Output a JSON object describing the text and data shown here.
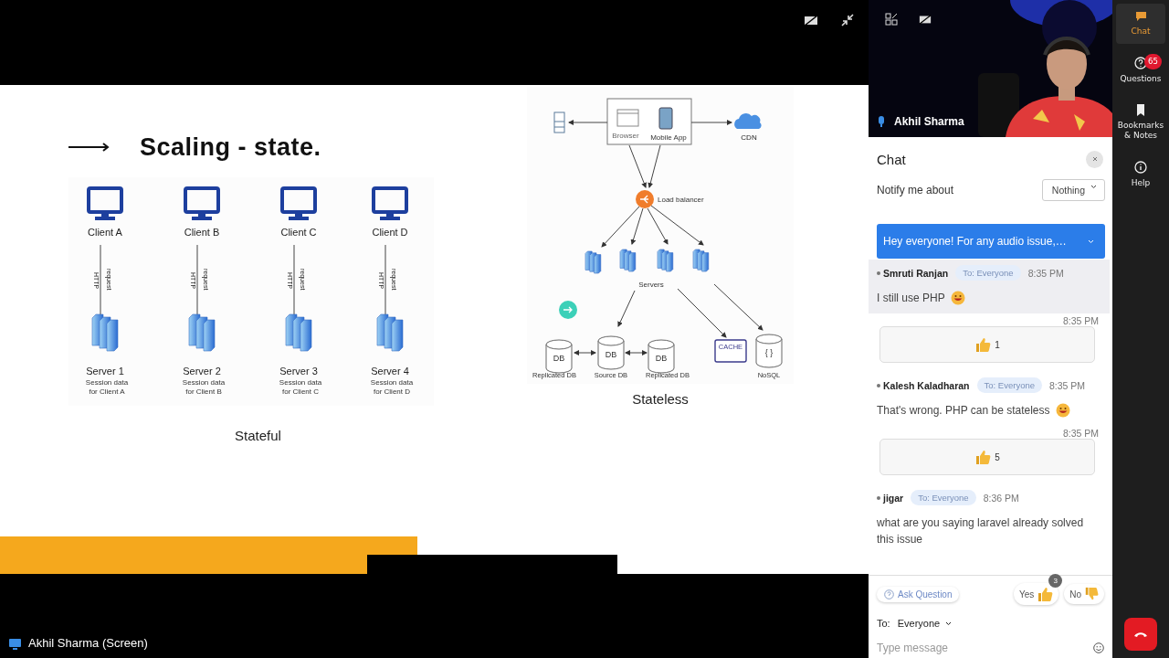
{
  "stage": {
    "presenter_label": "Akhil Sharma (Screen)",
    "slide": {
      "title": "Scaling - state.",
      "stateful": {
        "caption": "Stateful",
        "clients": [
          {
            "client": "Client A",
            "http": "HTTP",
            "request": "request",
            "server": "Server 1",
            "session": "Session data",
            "session_for": "for Client A"
          },
          {
            "client": "Client B",
            "http": "HTTP",
            "request": "request",
            "server": "Server 2",
            "session": "Session data",
            "session_for": "for Client B"
          },
          {
            "client": "Client C",
            "http": "HTTP",
            "request": "request",
            "server": "Server 3",
            "session": "Session data",
            "session_for": "for Client C"
          },
          {
            "client": "Client D",
            "http": "HTTP",
            "request": "request",
            "server": "Server 4",
            "session": "Session data",
            "session_for": "for Client D"
          }
        ]
      },
      "stateless": {
        "caption": "Stateless",
        "browser": "Browser",
        "mobile_app": "Mobile App",
        "cdn": "CDN",
        "load_balancer": "Load balancer",
        "servers": "Servers",
        "cache": "CACHE",
        "nosql_symbol": "{ }",
        "nosql": "NoSQL",
        "databases": [
          {
            "symbol": "DB",
            "label": "Replicated DB"
          },
          {
            "symbol": "DB",
            "label": "Source DB"
          },
          {
            "symbol": "DB",
            "label": "Replicated DB"
          }
        ]
      }
    }
  },
  "video": {
    "name": "Akhil Sharma",
    "mic_on": true
  },
  "chat": {
    "title": "Chat",
    "notify_label": "Notify me about",
    "notify_value": "Nothing",
    "pinned": "Hey everyone! For any audio issue,…",
    "messages": [
      {
        "kind": "message",
        "author": "Smruti Ranjan",
        "to": "To: Everyone",
        "time": "8:35 PM",
        "text": "I still use PHP",
        "emoji": true,
        "highlighted": true
      },
      {
        "kind": "reaction",
        "time": "8:35 PM",
        "count": "1"
      },
      {
        "kind": "message",
        "author": "Kalesh Kaladharan",
        "to": "To: Everyone",
        "time": "8:35 PM",
        "text": "That's wrong. PHP can be stateless",
        "emoji": true,
        "highlighted": false
      },
      {
        "kind": "reaction",
        "time": "8:35 PM",
        "count": "5"
      },
      {
        "kind": "message",
        "author": "jigar",
        "to": "To: Everyone",
        "time": "8:36 PM",
        "text": "what are you saying laravel already solved this issue",
        "emoji": false,
        "highlighted": false
      }
    ],
    "ask": "Ask Question",
    "yes": "Yes",
    "yes_count": "3",
    "no": "No",
    "to_label": "To:",
    "to_value": "Everyone",
    "placeholder": "Type message"
  },
  "rail": [
    {
      "kind": "chat",
      "label": "Chat",
      "selected": true
    },
    {
      "kind": "questions",
      "label": "Questions",
      "badge": "65",
      "selected": false
    },
    {
      "kind": "bookmarks",
      "label": "Bookmarks & Notes",
      "selected": false
    },
    {
      "kind": "help",
      "label": "Help",
      "selected": false
    }
  ]
}
